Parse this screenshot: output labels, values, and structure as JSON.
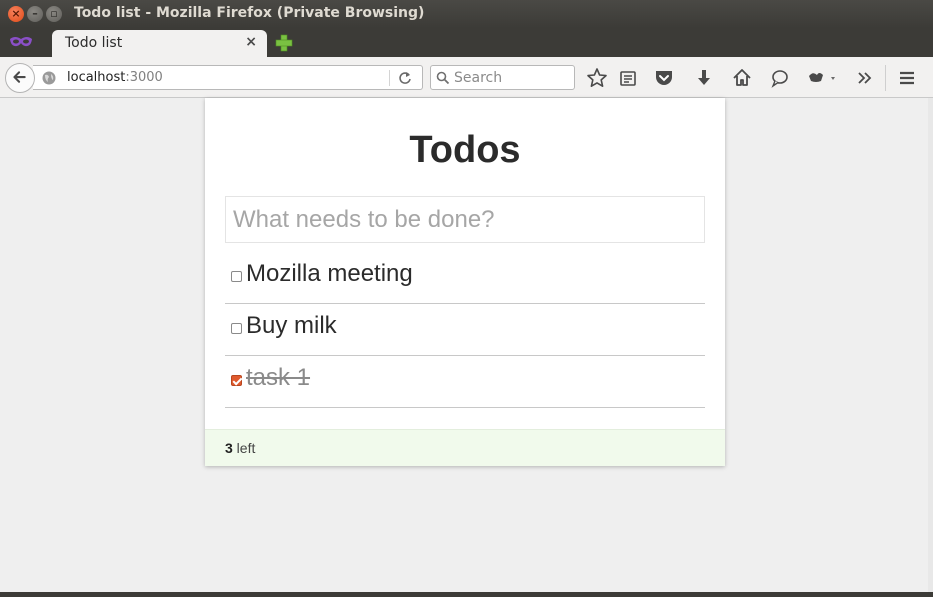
{
  "window": {
    "title": "Todo list - Mozilla Firefox (Private Browsing)"
  },
  "tab": {
    "label": "Todo list",
    "close": "×"
  },
  "navbar": {
    "url_host": "localhost",
    "url_port": ":3000",
    "search_placeholder": "Search"
  },
  "icons": [
    "private-browsing-icon",
    "new-tab-icon",
    "back-icon",
    "globe-icon",
    "reload-icon",
    "search-icon",
    "bookmark-star-icon",
    "reading-list-icon",
    "pocket-icon",
    "download-icon",
    "home-icon",
    "chat-icon",
    "extension-icon",
    "overflow-icon",
    "menu-icon"
  ],
  "app": {
    "title": "Todos",
    "new_todo_placeholder": "What needs to be done?",
    "todos": [
      {
        "label": "Mozilla meeting",
        "completed": false
      },
      {
        "label": "Buy milk",
        "completed": false
      },
      {
        "label": "task 1",
        "completed": true
      }
    ],
    "footer": {
      "count": "3",
      "suffix": " left"
    }
  },
  "colors": {
    "accent": "#e05a2e",
    "footer_bg": "#f1faec",
    "chrome": "#3c3b37"
  }
}
